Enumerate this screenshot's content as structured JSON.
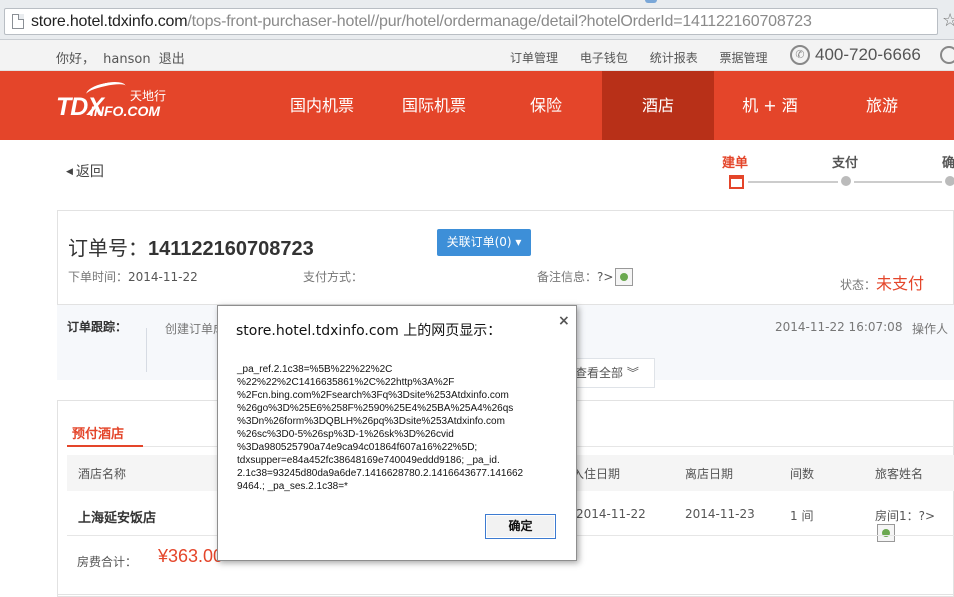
{
  "browser": {
    "url_host": "store.hotel.tdxinfo.com",
    "url_path": "/tops-front-purchaser-hotel//pur/hotel/ordermanage/detail?hotelOrderId=141122160708723"
  },
  "topbar": {
    "greeting": "你好，",
    "username": "hanson",
    "logout": "退出",
    "links": [
      "订单管理",
      "电子钱包",
      "统计报表",
      "票据管理"
    ],
    "phone": "400-720-6666"
  },
  "nav": {
    "logo_main": "TDX",
    "logo_sub": "INFO.COM",
    "logo_cn": "天地行",
    "items": [
      "国内机票",
      "国际机票",
      "保险",
      "酒店",
      "机 + 酒",
      "旅游"
    ],
    "active_index": 3
  },
  "page": {
    "back": "返回",
    "steps": [
      "建单",
      "支付",
      "确"
    ]
  },
  "order": {
    "title_label": "订单号：",
    "number": "141122160708723",
    "related_button": "关联订单(0) ▾",
    "order_time_label": "下单时间：",
    "order_time": "2014-11-22",
    "pay_method_label": "支付方式：",
    "remark_label": "备注信息：",
    "remark_value": "?>",
    "status_label": "状态：",
    "status_value": "未支付"
  },
  "tracking": {
    "label": "订单跟踪：",
    "text": "创建订单成",
    "time": "2014-11-22 16:07:08",
    "operator": "操作人",
    "view_all": "查看全部 ︾"
  },
  "hotel": {
    "tab": "预付酒店",
    "columns": [
      "酒店名称",
      "入住日期",
      "离店日期",
      "间数",
      "旅客姓名"
    ],
    "row": {
      "name": "上海延安饭店",
      "checkin": "2014-11-22",
      "checkout": "2014-11-23",
      "rooms": "1 间",
      "guest": "房间1：?>"
    },
    "total_label": "房费合计：",
    "total_value": "¥363.00"
  },
  "dialog": {
    "title": "store.hotel.tdxinfo.com 上的网页显示：",
    "close": "×",
    "message": "_pa_ref.2.1c38=%5B%22%22%2C\n%22%22%2C1416635861%2C%22http%3A%2F\n%2Fcn.bing.com%2Fsearch%3Fq%3Dsite%253Atdxinfo.com\n%26go%3D%25E6%258F%2590%25E4%25BA%25A4%26qs\n%3Dn%26form%3DQBLH%26pq%3Dsite%253Atdxinfo.com\n%26sc%3D0-5%26sp%3D-1%26sk%3D%26cvid\n%3Da980525790a74e9ca94c01864f607a16%22%5D;\ntdxsupper=e84a452fc38648169e740049eddd9186; _pa_id.\n2.1c38=93245d80da9a6de7.1416628780.2.1416643677.141662\n9464.; _pa_ses.2.1c38=*",
    "ok": "确定"
  }
}
